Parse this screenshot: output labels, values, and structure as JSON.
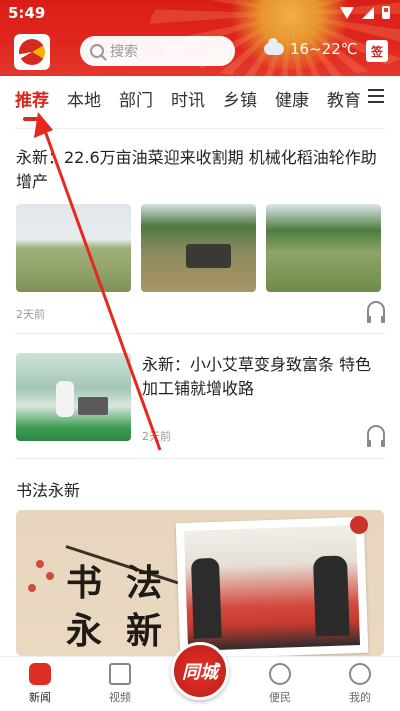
{
  "status_bar": {
    "time": "5:49"
  },
  "header": {
    "search_placeholder": "搜索",
    "weather": "16~22℃",
    "signin_label": "签",
    "icons": [
      "logo-icon",
      "search-icon",
      "cloud-icon",
      "signin-icon"
    ]
  },
  "tabs": [
    "推荐",
    "本地",
    "部门",
    "时讯",
    "乡镇",
    "健康",
    "教育"
  ],
  "active_tab": "推荐",
  "articles": [
    {
      "title": "永新：22.6万亩油菜迎来收割期 机械化稻油轮作助增产",
      "time": "2天前"
    },
    {
      "title": "永新：小小艾草变身致富条 特色加工铺就增收路",
      "time": "2天前"
    }
  ],
  "section": {
    "title": "书法永新",
    "banner_chars": [
      "书",
      "法",
      "永",
      "新"
    ]
  },
  "bottom_nav": [
    {
      "label": "新闻",
      "icon": "news-icon",
      "active": true
    },
    {
      "label": "视频",
      "icon": "video-icon",
      "active": false
    },
    {
      "label": "同城",
      "icon": "city-icon",
      "active": false
    },
    {
      "label": "便民",
      "icon": "service-icon",
      "active": false
    },
    {
      "label": "我的",
      "icon": "profile-icon",
      "active": false
    }
  ],
  "colors": {
    "brand_red": "#d42a20",
    "annotation_red": "#e8271f"
  }
}
